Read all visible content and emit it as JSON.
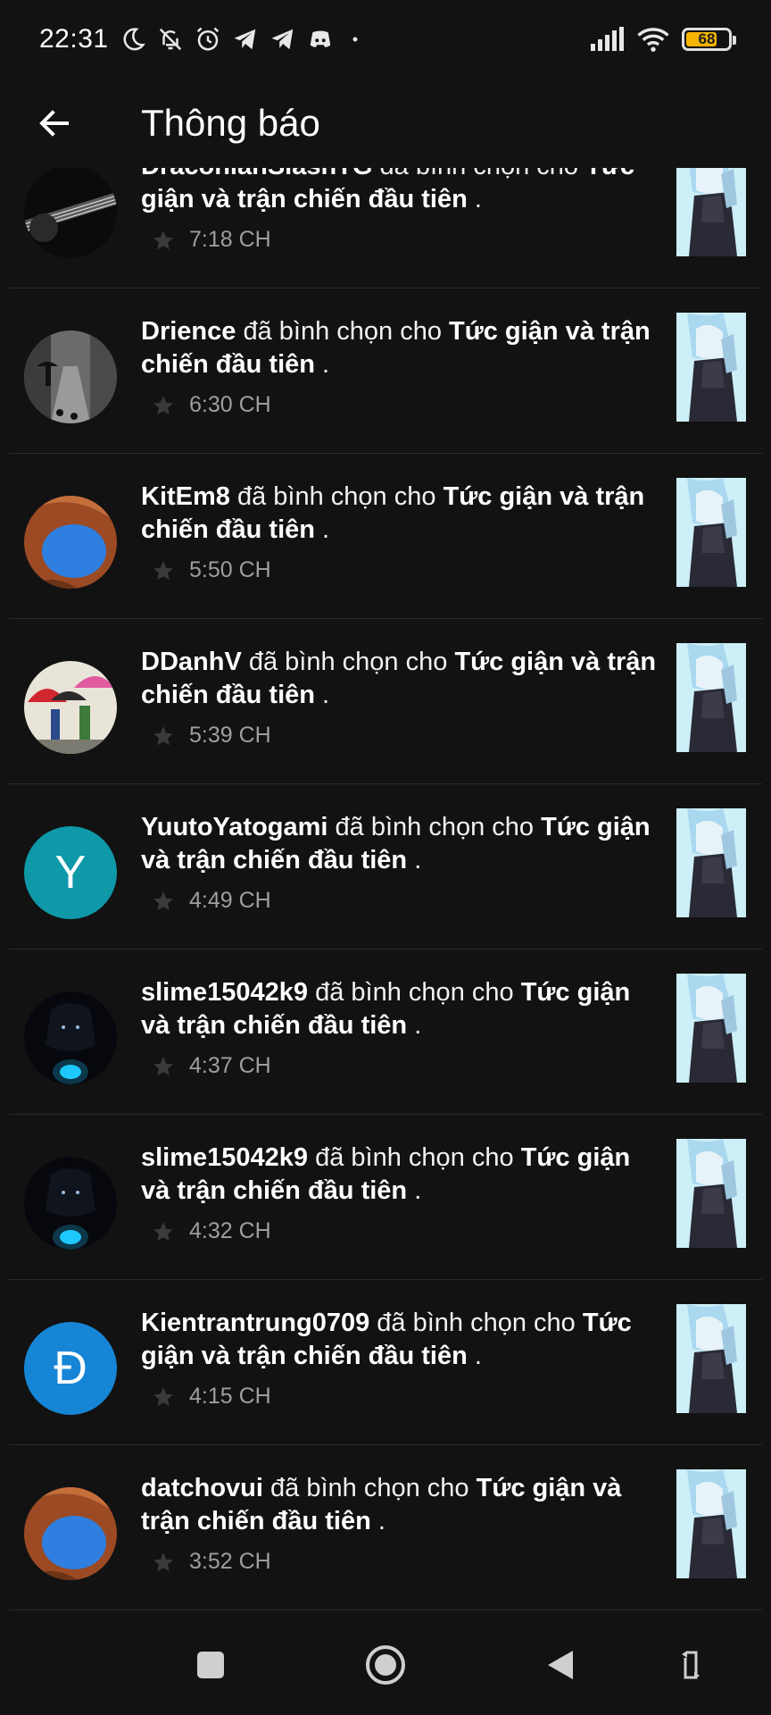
{
  "status_bar": {
    "time": "22:31",
    "battery": "68",
    "battery_level": 0.68,
    "icons": [
      "moon-icon",
      "bell-off-icon",
      "alarm-icon",
      "telegram-icon",
      "telegram-icon",
      "discord-icon",
      "dot-icon",
      "signal-icon",
      "wifi-icon",
      "battery-icon"
    ]
  },
  "header": {
    "title": "Thông báo",
    "back_icon": "arrow-left-icon"
  },
  "notifications": [
    {
      "user": "DraconianSlashTG",
      "action": " đã bình chọn cho ",
      "story": "Tức giận và trận chiến đầu tiên",
      "suffix": " .",
      "time": "7:18 CH",
      "avatar_type": "guitar"
    },
    {
      "user": "Drience",
      "action": " đã bình chọn cho ",
      "story": "Tức giận và trận chiến đầu tiên",
      "suffix": " .",
      "time": "6:30 CH",
      "avatar_type": "street"
    },
    {
      "user": "KitEm8",
      "action": " đã bình chọn cho ",
      "story": "Tức giận và trận chiến đầu tiên",
      "suffix": " .",
      "time": "5:50 CH",
      "avatar_type": "arch"
    },
    {
      "user": "DDanhV",
      "action": " đã bình chọn cho ",
      "story": "Tức giận và trận chiến đầu tiên",
      "suffix": " .",
      "time": "5:39 CH",
      "avatar_type": "umbrella"
    },
    {
      "user": "YuutoYatogami",
      "action": " đã bình chọn cho ",
      "story": "Tức giận và trận chiến đầu tiên",
      "suffix": " .",
      "time": "4:49 CH",
      "avatar_type": "letter",
      "avatar_letter": "Y",
      "avatar_color": "#0e98a8"
    },
    {
      "user": "slime15042k9",
      "action": " đã bình chọn cho ",
      "story": "Tức giận và trận chiến đầu tiên",
      "suffix": " .",
      "time": "4:37 CH",
      "avatar_type": "dark"
    },
    {
      "user": "slime15042k9",
      "action": " đã bình chọn cho ",
      "story": "Tức giận và trận chiến đầu tiên",
      "suffix": " .",
      "time": "4:32 CH",
      "avatar_type": "dark"
    },
    {
      "user": "Kientrantrung0709",
      "action": " đã bình chọn cho ",
      "story": "Tức giận và trận chiến đầu tiên",
      "suffix": " .",
      "time": "4:15 CH",
      "avatar_type": "letter",
      "avatar_letter": "Đ",
      "avatar_color": "#1785d6"
    },
    {
      "user": "datchovui",
      "action": " đã bình chọn cho ",
      "story": "Tức giận và trận chiến đầu tiên",
      "suffix": " .",
      "time": "3:52 CH",
      "avatar_type": "arch"
    }
  ],
  "nav": {
    "icons": [
      "square-icon",
      "home-circle-icon",
      "back-triangle-icon",
      "rotate-icon"
    ]
  },
  "colors": {
    "background": "#121212",
    "divider": "#2b2b2b",
    "time_text": "#9e9e9e",
    "battery": "#f4b400"
  }
}
